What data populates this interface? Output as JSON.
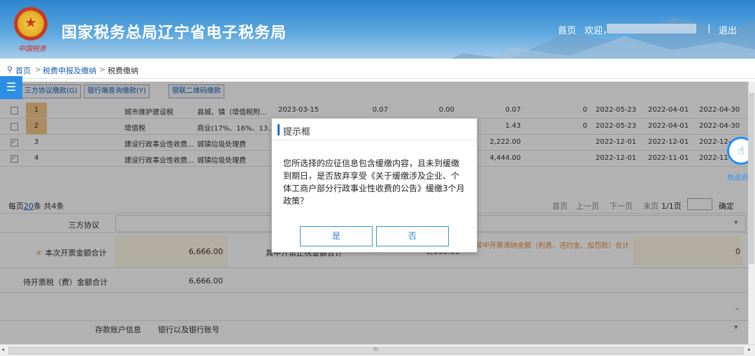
{
  "header": {
    "seal_signature": "中国税务",
    "site_title": "国家税务总局辽宁省电子税务局",
    "nav_home": "首页",
    "nav_welcome": "欢迎，",
    "nav_sep": "|",
    "nav_logout": "退出"
  },
  "breadcrumb": {
    "home": "首页",
    "sep1": ">",
    "level1": "税费申报及缴纳",
    "sep2": ">",
    "level2": "税费缴纳"
  },
  "toolbar": {
    "btn1": "三方协议缴款(G)",
    "btn2": "银行端查询缴款(Y)",
    "btn3": "银联二维码缴款"
  },
  "table": {
    "rows": [
      {
        "idx": "1",
        "tax": "城市维护建设税",
        "item": "县城、镇（增值税附...",
        "date": "2023-03-15",
        "c1": "0.07",
        "c2": "0.00",
        "c3": "0.07",
        "c4": "0",
        "d1": "2022-05-23",
        "d2": "2022-04-01",
        "d3": "2022-04-30"
      },
      {
        "idx": "2",
        "tax": "增值税",
        "item": "商业(17%、16%、13...",
        "date": "",
        "c1": "",
        "c2": "",
        "c3": "1.43",
        "c4": "0",
        "d1": "2022-05-23",
        "d2": "2022-04-01",
        "d3": "2022-04-30"
      },
      {
        "idx": "3",
        "tax": "建设行政事业性收费...",
        "item": "城镇垃圾处理费",
        "date": "",
        "c1": "",
        "c2": "",
        "c3": "2,222.00",
        "c4": "",
        "d1": "2022-12-01",
        "d2": "2022-12-01",
        "d3": "2022-12-"
      },
      {
        "idx": "4",
        "tax": "建设行政事业性收费...",
        "item": "城镇垃圾处理费",
        "date": "",
        "c1": "",
        "c2": "",
        "c3": "4,444.00",
        "c4": "",
        "d1": "2022-12-01",
        "d2": "2022-11-01",
        "d3": "2022-11-"
      }
    ]
  },
  "pagination": {
    "per_page_prefix": "每页",
    "per_page": "20",
    "per_page_suffix": "条 共4条",
    "first": "首页",
    "prev": "上一页",
    "next": "下一页",
    "last": "末页",
    "page_info": "1/1页",
    "confirm": "确定"
  },
  "summary": {
    "agreement_label": "三方协议",
    "invoice_total_label": "本次开票金额合计",
    "invoice_total_value": "6,666.00",
    "middle_label": "其中开票正税金额合计",
    "middle_value": "6,666.00",
    "right_label": "其中开票滞纳金额（利息、违约金、加罚款）合计",
    "right_value": "0",
    "pending_label": "待开票税（费）金额合计",
    "pending_value": "6,666.00",
    "deposit_label": "存款账户信息",
    "bank_label": "银行以及银行账号"
  },
  "side": {
    "menu_icon": "☰",
    "hot_label": "热点问题"
  },
  "scroll": {
    "h_grip": "III"
  },
  "dialog": {
    "title": "提示框",
    "message": "您所选择的应征信息包含缓缴内容，且未到缓缴到期日，是否放弃享受《关于缓缴涉及企业、个体工商户部分行政事业性收费的公告》缓缴3个月政策？",
    "yes": "是",
    "no": "否"
  }
}
